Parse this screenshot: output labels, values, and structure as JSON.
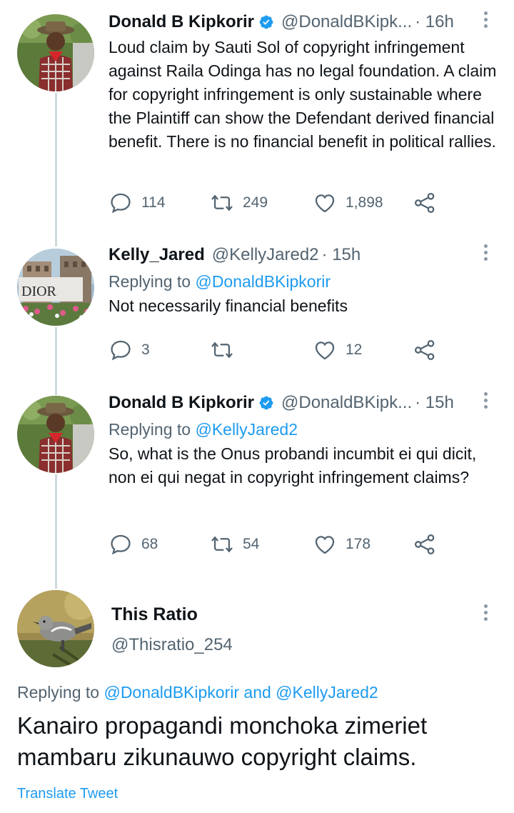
{
  "tweets": [
    {
      "name": "Donald B Kipkorir",
      "handle": "@DonaldBKipk...",
      "time": "· 16h",
      "verified": true,
      "body": "Loud claim by Sauti Sol of copyright infringement against Raila Odinga has no legal foundation. A claim for copyright infringement is only sustainable where the Plaintiff can show the Defendant derived financial benefit. There is no financial benefit in political rallies.",
      "replies": "114",
      "retweets": "249",
      "likes": "1,898"
    },
    {
      "name": "Kelly_Jared",
      "handle": "@KellyJared2",
      "time": "· 15h",
      "verified": false,
      "replying_prefix": "Replying to",
      "replying_to": "@DonaldBKipkorir",
      "body": "Not necessarily  financial  benefits",
      "replies": "3",
      "retweets": "",
      "likes": "12",
      "avatar_text": "DIOR"
    },
    {
      "name": "Donald B Kipkorir",
      "handle": "@DonaldBKipk...",
      "time": "· 15h",
      "verified": true,
      "replying_prefix": "Replying to",
      "replying_to": "@KellyJared2",
      "body": "So, what is the Onus probandi incumbit ei qui dicit, non ei qui negat in copyright infringement claims?",
      "replies": "68",
      "retweets": "54",
      "likes": "178"
    }
  ],
  "main_tweet": {
    "name": "This Ratio",
    "handle": "@Thisratio_254",
    "replying_prefix": "Replying to",
    "replying_to_1": "@DonaldBKipkorir",
    "replying_and": "and",
    "replying_to_2": "@KellyJared2",
    "body": "Kanairo propagandi monchoka zimeriet mambaru zikunauwo copyright claims.",
    "translate": "Translate Tweet"
  },
  "colors": {
    "accent": "#1d9bf0",
    "secondary_text": "#536471",
    "thread_line": "#cfd9de"
  },
  "icons": [
    "reply-icon",
    "retweet-icon",
    "like-icon",
    "share-icon",
    "verified-badge-icon",
    "more-icon"
  ]
}
